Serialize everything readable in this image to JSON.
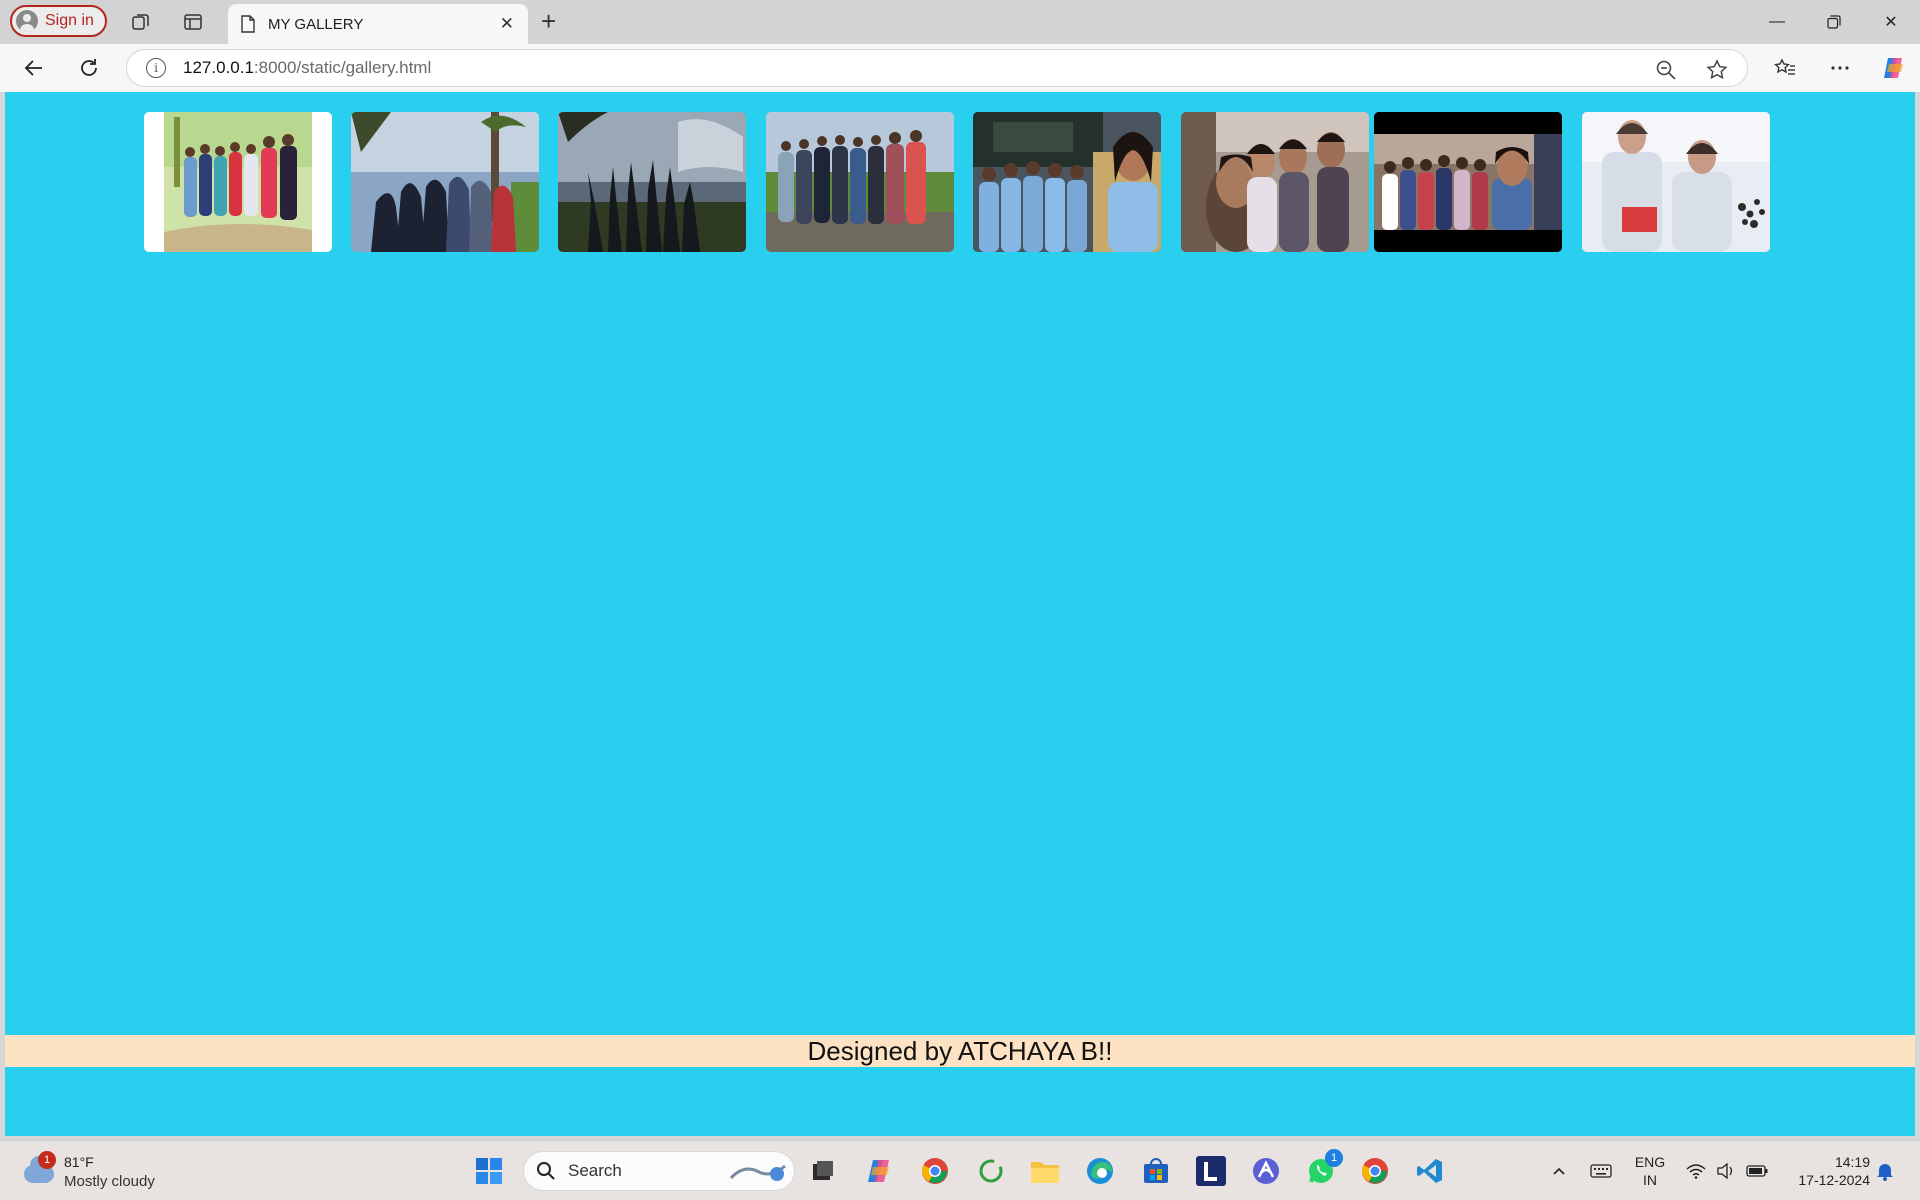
{
  "browser": {
    "signin_label": "Sign in",
    "tab_title": "MY GALLERY",
    "url_host": "127.0.0.1",
    "url_path": ":8000/static/gallery.html"
  },
  "gallery": {
    "images": [
      {
        "alt": "group photo 1"
      },
      {
        "alt": "group photo 2"
      },
      {
        "alt": "group photo 3"
      },
      {
        "alt": "group photo 4"
      },
      {
        "alt": "group photo 5"
      },
      {
        "alt": "group photo 6"
      },
      {
        "alt": "group photo 7"
      },
      {
        "alt": "group photo 8"
      }
    ]
  },
  "footer": {
    "text": "Designed by ATCHAYA B!!"
  },
  "colors": {
    "page_background": "#29cfef",
    "footer_band": "#fde3c4"
  },
  "taskbar": {
    "weather_badge": "1",
    "weather_temp": "81°F",
    "weather_condition": "Mostly cloudy",
    "search_label": "Search",
    "whatsapp_badge": "1",
    "lang_line1": "ENG",
    "lang_line2": "IN",
    "time": "14:19",
    "date": "17-12-2024",
    "icons": [
      "windows-start-icon",
      "search-icon",
      "task-view-icon",
      "copilot-icon",
      "chrome-icon",
      "refresh-app-icon",
      "file-explorer-icon",
      "edge-icon",
      "store-icon",
      "l-app-icon",
      "arc-icon",
      "whatsapp-icon",
      "chrome-icon",
      "vscode-icon"
    ]
  }
}
